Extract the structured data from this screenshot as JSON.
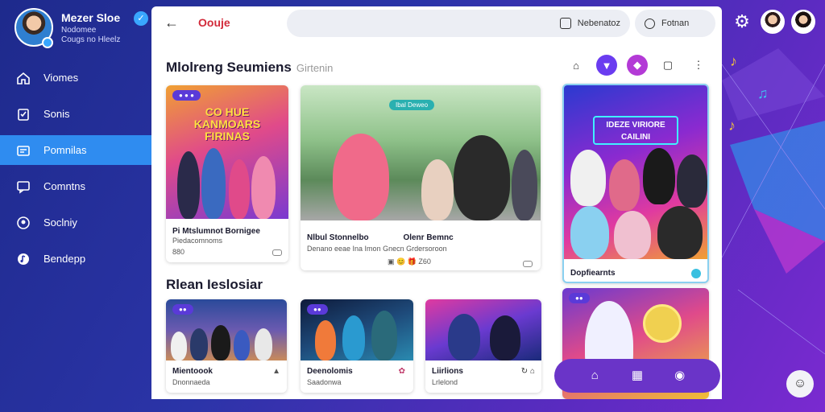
{
  "profile": {
    "name": "Mezer Sloe",
    "subtitle1": "Nodomee",
    "subtitle2": "Cougs no Hleelz"
  },
  "nav": {
    "items": [
      {
        "label": "Viomes",
        "icon": "home-icon"
      },
      {
        "label": "Sonis",
        "icon": "clipboard-icon"
      },
      {
        "label": "Pomnilas",
        "icon": "folder-icon",
        "active": true
      },
      {
        "label": "Comntns",
        "icon": "chat-icon"
      },
      {
        "label": "Soclniy",
        "icon": "people-icon"
      },
      {
        "label": "Bendepp",
        "icon": "music-icon"
      }
    ]
  },
  "topbar": {
    "title": "Oouje",
    "search_label": "Nebenatoz",
    "filter_label": "Fotnan"
  },
  "sections": {
    "first": {
      "title": "Mlolreng Seumiens",
      "subtitle": "Girtenin"
    },
    "second": {
      "title": "Rlean Ieslosiar"
    }
  },
  "cards": {
    "a": {
      "title": "Pi Mtslumnot Bornigee",
      "meta": "Piedacomnoms",
      "count": "880",
      "poster": "CO HUE KANMOARS FIRINAS"
    },
    "b": {
      "title_left": "Nlbul Stonnelbo",
      "title_right": "Olenr Bemnc",
      "meta": "Denano eeae Ina Imon Gnecn Grdersoroon",
      "count": "Z60",
      "tag": "Ibal Deweo"
    },
    "c": {
      "title": "Dopfiearnts",
      "poster": "IDEZE VIRIORE CAILINI"
    },
    "d": {
      "title": "Mientoook",
      "meta": "Dnonnaeda"
    },
    "e": {
      "title": "Deenolomis",
      "meta": "Saadonwa"
    },
    "f": {
      "title": "Liirlions",
      "meta": "Lrlelond"
    }
  },
  "colors": {
    "accent": "#2f8cf0",
    "title_red": "#d22a3a",
    "bottom_bar": "#6a34c8"
  }
}
